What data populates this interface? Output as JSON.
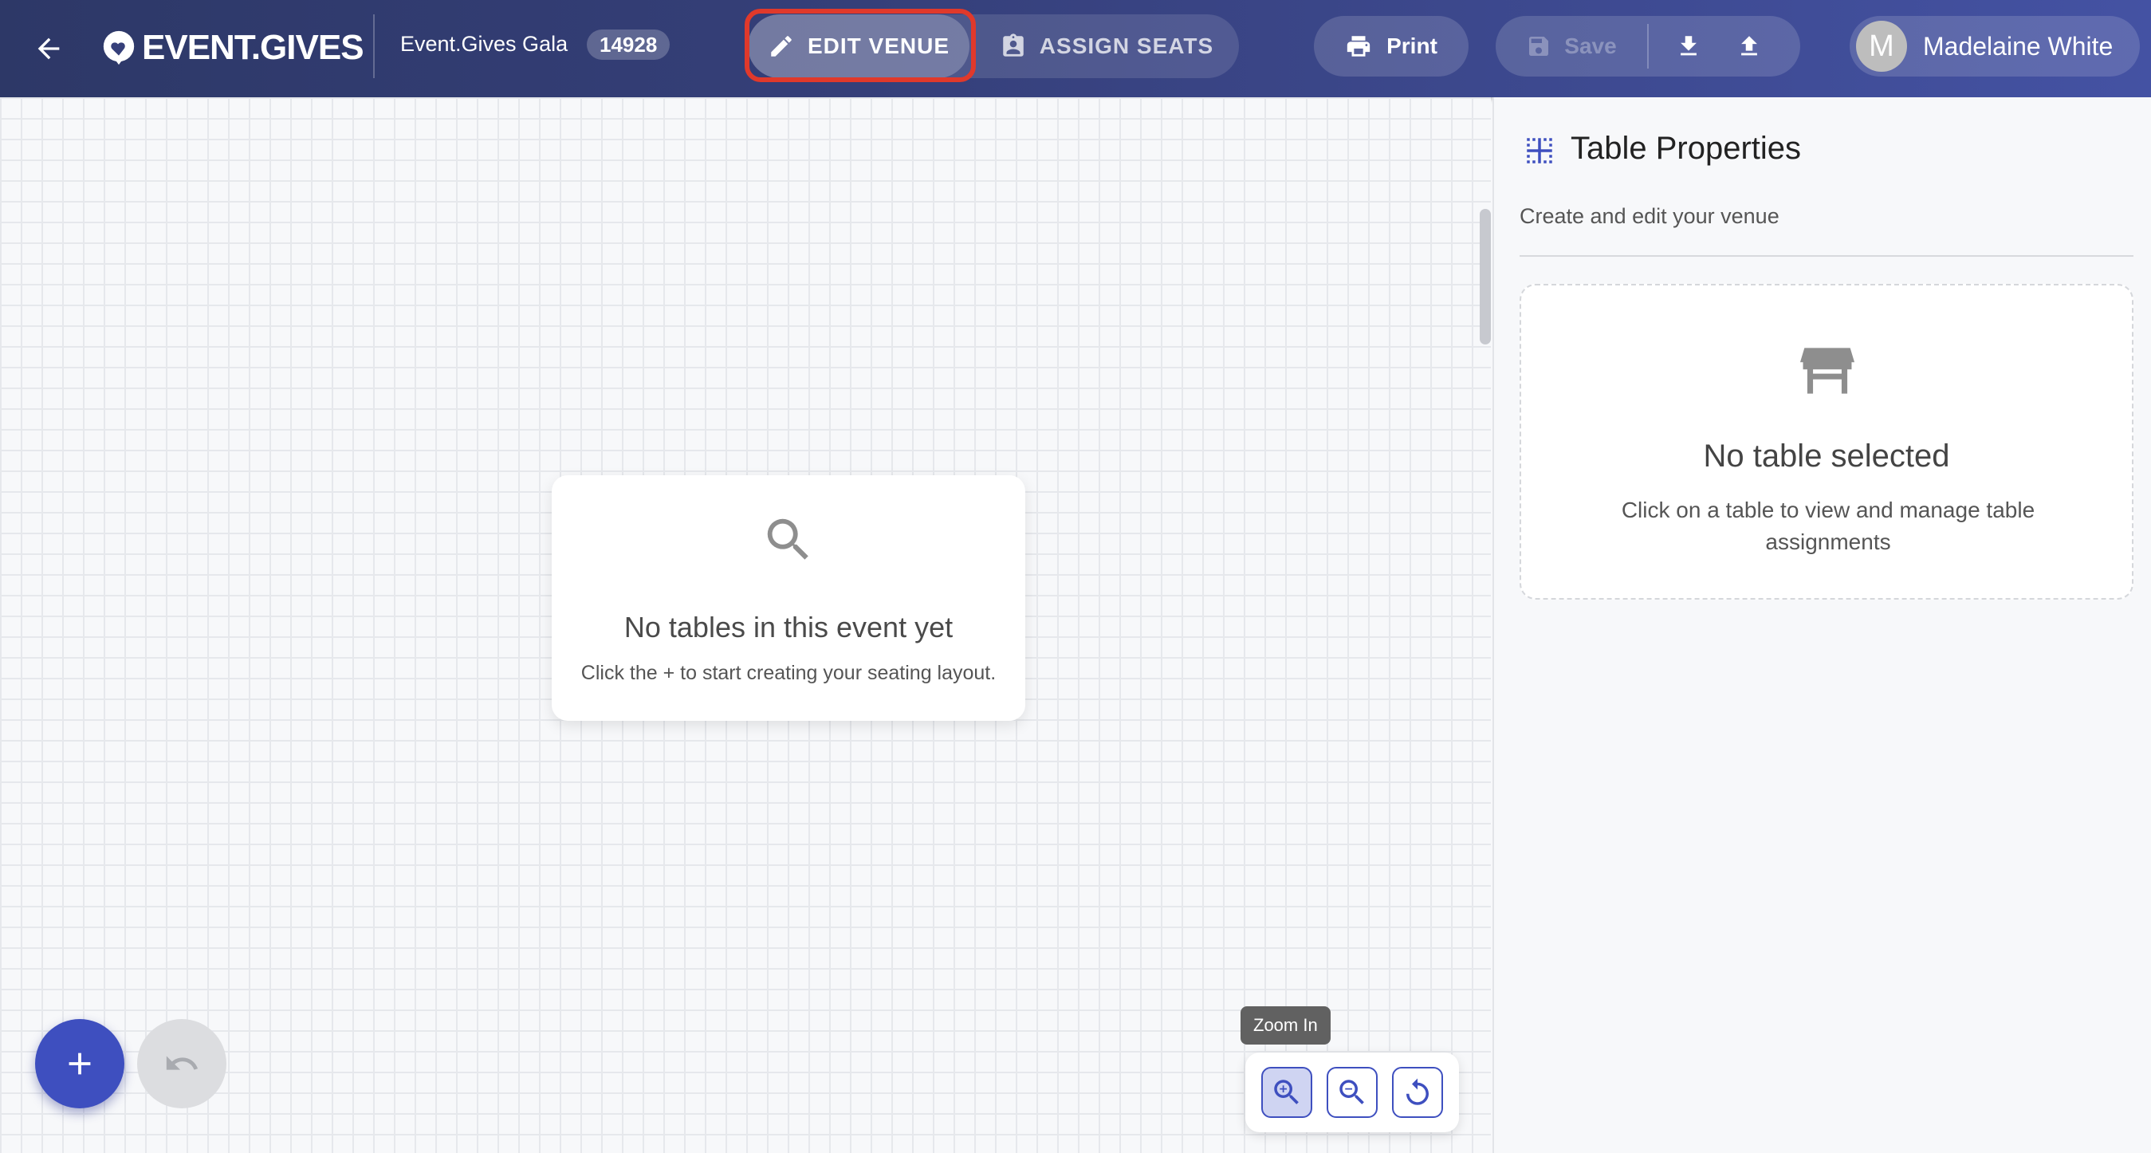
{
  "header": {
    "logo_text": "EVENT.GIVES",
    "event_name": "Event.Gives Gala",
    "event_id": "14928",
    "modes": [
      {
        "label": "EDIT VENUE",
        "icon": "pencil-icon",
        "active": true
      },
      {
        "label": "ASSIGN SEATS",
        "icon": "clipboard-user-icon",
        "active": false
      }
    ],
    "print_label": "Print",
    "save_label": "Save",
    "user": {
      "initial": "M",
      "name": "Madelaine White"
    }
  },
  "canvas": {
    "empty_title": "No tables in this event yet",
    "empty_subtitle": "Click the + to start creating your seating layout.",
    "add_label": "+",
    "zoom_tooltip": "Zoom In",
    "zoom_controls": [
      "zoom-in-icon",
      "zoom-out-icon",
      "reset-rotate-icon"
    ]
  },
  "panel": {
    "title": "Table Properties",
    "subtitle": "Create and edit your venue",
    "empty_title": "No table selected",
    "empty_subtitle": "Click on a table to view and manage table assignments"
  },
  "colors": {
    "header_start": "#2d3867",
    "header_end": "#4452a3",
    "accent": "#3e4fbf",
    "highlight": "#e0392b"
  }
}
